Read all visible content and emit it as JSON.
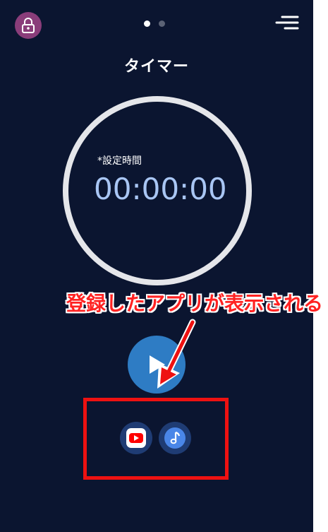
{
  "header": {
    "lock_icon": "lock-icon",
    "page_indicator": {
      "count": 2,
      "active": 1
    },
    "menu_icon": "menu-icon"
  },
  "timer": {
    "title": "タイマー",
    "set_time_label": "*設定時間",
    "time_value": "00:00:00"
  },
  "controls": {
    "play_icon": "play-icon"
  },
  "registered_apps": [
    {
      "name": "YouTube",
      "icon": "youtube-icon"
    },
    {
      "name": "Music",
      "icon": "music-note-icon"
    }
  ],
  "annotation": {
    "text": "登録したアプリが表示される",
    "color": "#ff2222"
  },
  "colors": {
    "background": "#0b1530",
    "accent": "#2e7cc4",
    "time_text": "#a9c6f4",
    "lock_button": "#8a3d7a",
    "highlight_box": "#ee1111"
  }
}
